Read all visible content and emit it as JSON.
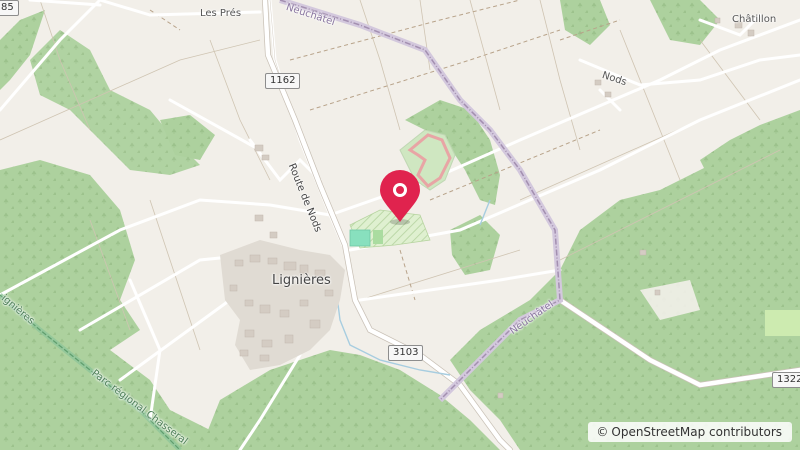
{
  "map": {
    "places": {
      "les_pres": "Les Prés",
      "chatillon": "Châtillon",
      "lignieres": "Lignières",
      "nods": "Nods"
    },
    "roads": {
      "route_de_nods": "Route de Nods"
    },
    "route_shields": {
      "r1162": "1162",
      "r3103": "3103",
      "r1322": "1322",
      "r85": "85"
    },
    "boundaries": {
      "neuchatel_top": "Neuchâtel",
      "neuchatel_right": "Neuchâtel",
      "lignieres_edge": "ignières",
      "parc_regional": "Parc régional Chasseral"
    },
    "attribution": "OpenStreetMap contributors",
    "attribution_symbol": "©",
    "marker_color": "#e0234e",
    "colors": {
      "background": "#f2efe9",
      "forest": "#add19e",
      "road": "#ffffff",
      "boundary": "#a38fb0"
    }
  }
}
